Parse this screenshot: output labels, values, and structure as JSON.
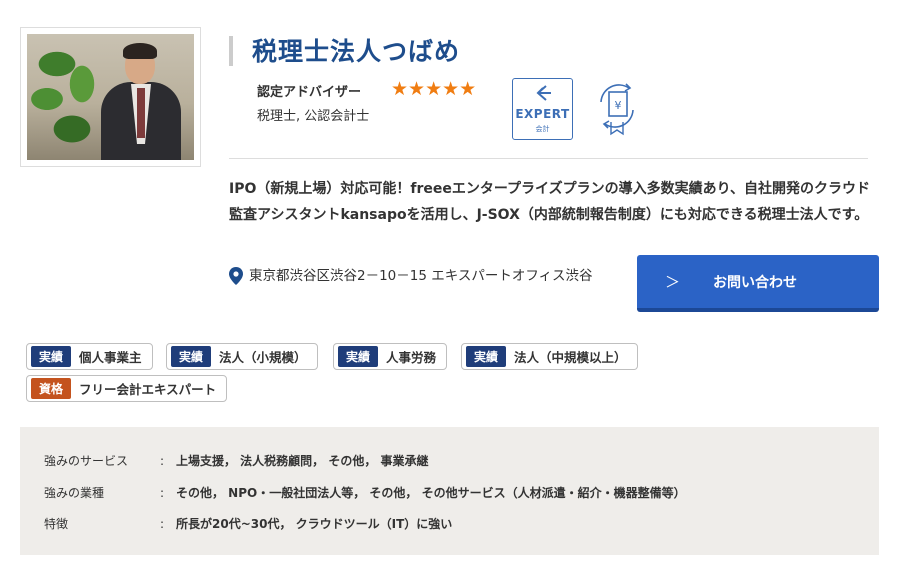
{
  "office": {
    "name": "税理士法人つばめ",
    "role": "認定アドバイザー",
    "rating_stars": 5,
    "stars_text": "★★★★★",
    "qualifications": "税理士, 公認会計士",
    "badge": {
      "word": "EXPERT",
      "sub": "会計"
    },
    "description": "IPO（新規上場）対応可能！freeeエンタープライズプランの導入多数実績あり、自社開発のクラウド監査アシスタントkansapoを活用し、J-SOX（内部統制報告制度）にも対応できる税理士法人です。",
    "address": "東京都渋谷区渋谷2－10－15 エキスパートオフィス渋谷"
  },
  "inquiry_button": {
    "chevron": "＞",
    "label": "お問い合わせ"
  },
  "tags": [
    {
      "kind": "実績",
      "value": "個人事業主"
    },
    {
      "kind": "実績",
      "value": "法人（小規模）"
    },
    {
      "kind": "実績",
      "value": "人事労務"
    },
    {
      "kind": "実績",
      "value": "法人（中規模以上）"
    },
    {
      "kind": "資格",
      "value": "フリー会計エキスパート"
    }
  ],
  "details": [
    {
      "label": "強みのサービス",
      "sep": ":",
      "value": "上場支援，  法人税務顧問，  その他，  事業承継"
    },
    {
      "label": "強みの業種",
      "sep": ":",
      "value": "その他，  NPO・一般社団法人等，  その他，  その他サービス（人材派遣・紹介・機器整備等）"
    },
    {
      "label": "特徴",
      "sep": ":",
      "value": "所長が20代~30代，  クラウドツール（IT）に強い"
    }
  ],
  "colors": {
    "title": "#1e4d8c",
    "star": "#f07d12",
    "button": "#2b63c6",
    "tag_jisseki": "#1f3d7a",
    "tag_shikaku": "#c4531e",
    "details_bg": "#efedea"
  },
  "icons": {
    "badge": "expert-badge-icon",
    "yen": "yen-document-icon",
    "pin": "location-pin-icon"
  }
}
